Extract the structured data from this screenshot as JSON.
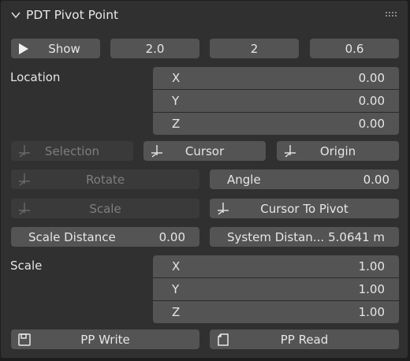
{
  "header": {
    "title": "PDT Pivot Point"
  },
  "top_row": {
    "show_label": "Show",
    "value1": "2.0",
    "value2": "2",
    "value3": "0.6"
  },
  "location": {
    "label": "Location",
    "rows": [
      {
        "axis": "X",
        "value": "0.00"
      },
      {
        "axis": "Y",
        "value": "0.00"
      },
      {
        "axis": "Z",
        "value": "0.00"
      }
    ]
  },
  "pivot_buttons": {
    "selection": "Selection",
    "cursor": "Cursor",
    "origin": "Origin"
  },
  "rotate": {
    "label": "Rotate",
    "angle_label": "Angle",
    "angle_value": "0.00"
  },
  "scale_row": {
    "label": "Scale",
    "cursor_to_pivot": "Cursor To Pivot"
  },
  "distance": {
    "scale_label": "Scale Distance",
    "scale_value": "0.00",
    "system_label": "System Distan...",
    "system_value": "5.0641 m"
  },
  "scale": {
    "label": "Scale",
    "rows": [
      {
        "axis": "X",
        "value": "1.00"
      },
      {
        "axis": "Y",
        "value": "1.00"
      },
      {
        "axis": "Z",
        "value": "1.00"
      }
    ]
  },
  "footer": {
    "write": "PP Write",
    "read": "PP Read"
  },
  "icons": {
    "collapse": "chevron-down-icon",
    "drag": "grip-dots-icon",
    "play": "play-icon",
    "pivot": "cursor-crosshair-icon",
    "save": "save-icon",
    "read": "file-icon"
  },
  "colors": {
    "panel": "#303030",
    "button": "#545454",
    "disabled": "#3a3a3a",
    "text": "#e6e6e6"
  }
}
